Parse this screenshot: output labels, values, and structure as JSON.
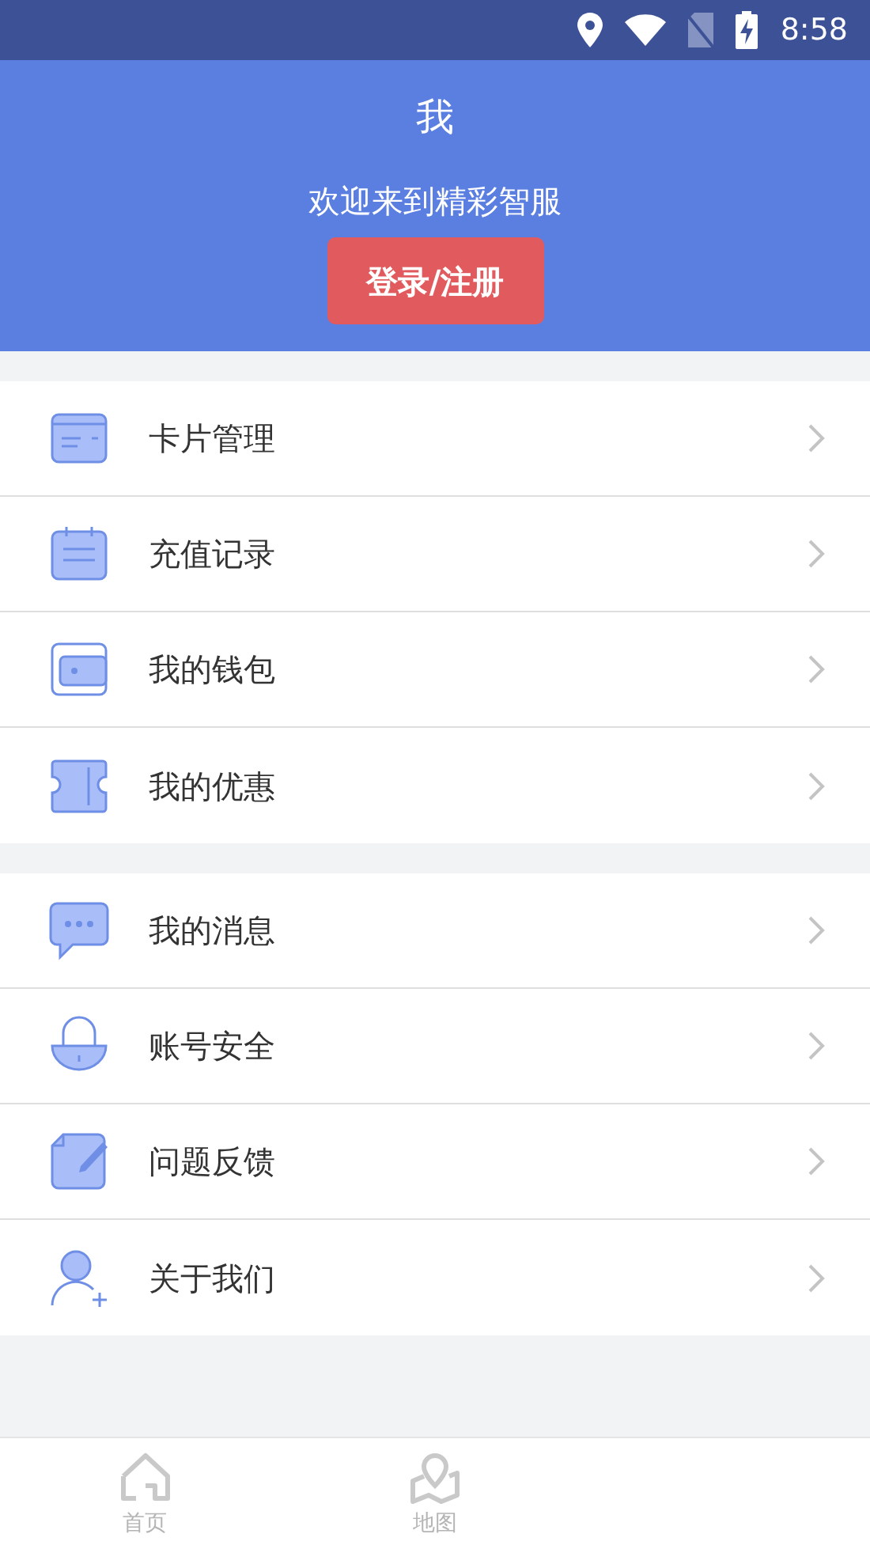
{
  "status_bar": {
    "time": "8:58"
  },
  "header": {
    "title": "我",
    "welcome": "欢迎来到精彩智服",
    "login_button": "登录/注册"
  },
  "menu_groups": [
    {
      "items": [
        {
          "label": "卡片管理"
        },
        {
          "label": "充值记录"
        },
        {
          "label": "我的钱包"
        },
        {
          "label": "我的优惠"
        }
      ]
    },
    {
      "items": [
        {
          "label": "我的消息"
        },
        {
          "label": "账号安全"
        },
        {
          "label": "问题反馈"
        },
        {
          "label": "关于我们"
        }
      ]
    }
  ],
  "tab_bar": [
    {
      "label": "首页",
      "selected": false
    },
    {
      "label": "地图",
      "selected": false
    }
  ]
}
